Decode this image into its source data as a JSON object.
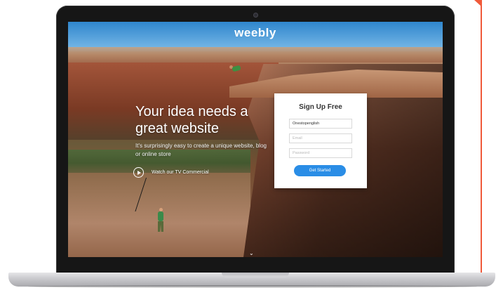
{
  "brand": {
    "logo_text": "weebly"
  },
  "hero": {
    "headline": "Your idea needs a great website",
    "subtext": "It's surprisingly easy to create a unique website, blog or online store",
    "commercial_link": "Watch our TV Commercial"
  },
  "signup": {
    "title": "Sign Up Free",
    "name_value": "Onestopenglish",
    "email_placeholder": "Email",
    "password_placeholder": "Password",
    "button_label": "Get Started"
  },
  "scroll": {
    "indicator": "⌄"
  },
  "colors": {
    "accent": "#2a8de6",
    "frame_accent": "#f05a3a",
    "bezel": "#161616"
  }
}
